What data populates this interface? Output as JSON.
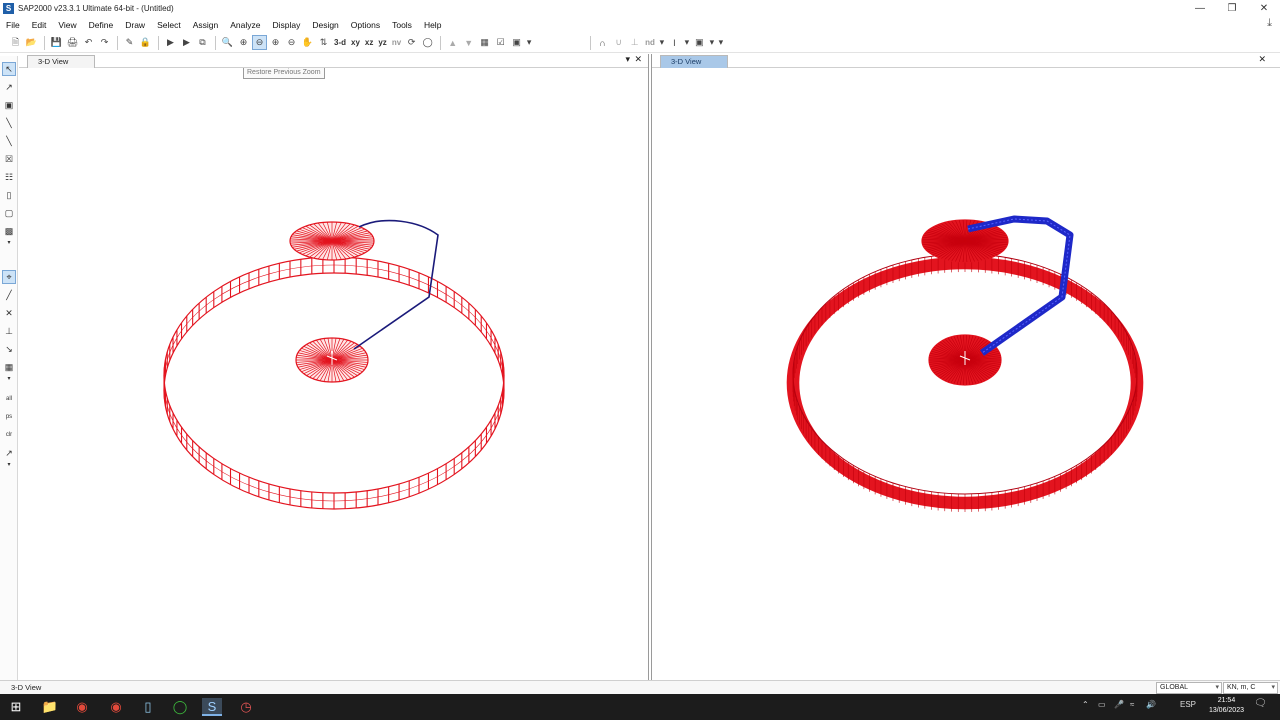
{
  "window": {
    "title": "SAP2000 v23.3.1 Ultimate 64-bit - (Untitled)",
    "app_icon": "S"
  },
  "menu": [
    "File",
    "Edit",
    "View",
    "Define",
    "Draw",
    "Select",
    "Assign",
    "Analyze",
    "Display",
    "Design",
    "Options",
    "Tools",
    "Help"
  ],
  "toolbar": {
    "view_3d": "3-d",
    "view_xy": "xy",
    "view_xz": "xz",
    "view_yz": "yz",
    "view_nv": "nv",
    "nd_label": "nd",
    "tooltip": "Restore Previous Zoom"
  },
  "left_pane": {
    "tab": "3-D View"
  },
  "right_pane": {
    "tab": "3-D View"
  },
  "status": {
    "left_text": "3-D View",
    "coord_system": "GLOBAL",
    "units": "KN, m, C"
  },
  "taskbar": {
    "language": "ESP",
    "time": "21:54",
    "date": "13/06/2023",
    "notifications": "3"
  },
  "colors": {
    "model_red": "#e3141f",
    "frame_blue": "#1e28c8",
    "frame_navy": "#1a1a7a"
  },
  "icons": [
    "windows-start-icon",
    "file-explorer-icon",
    "chrome-icon",
    "chrome-alt-icon",
    "notes-icon",
    "circle-app-icon",
    "sap2000-icon",
    "clock-app-icon"
  ]
}
